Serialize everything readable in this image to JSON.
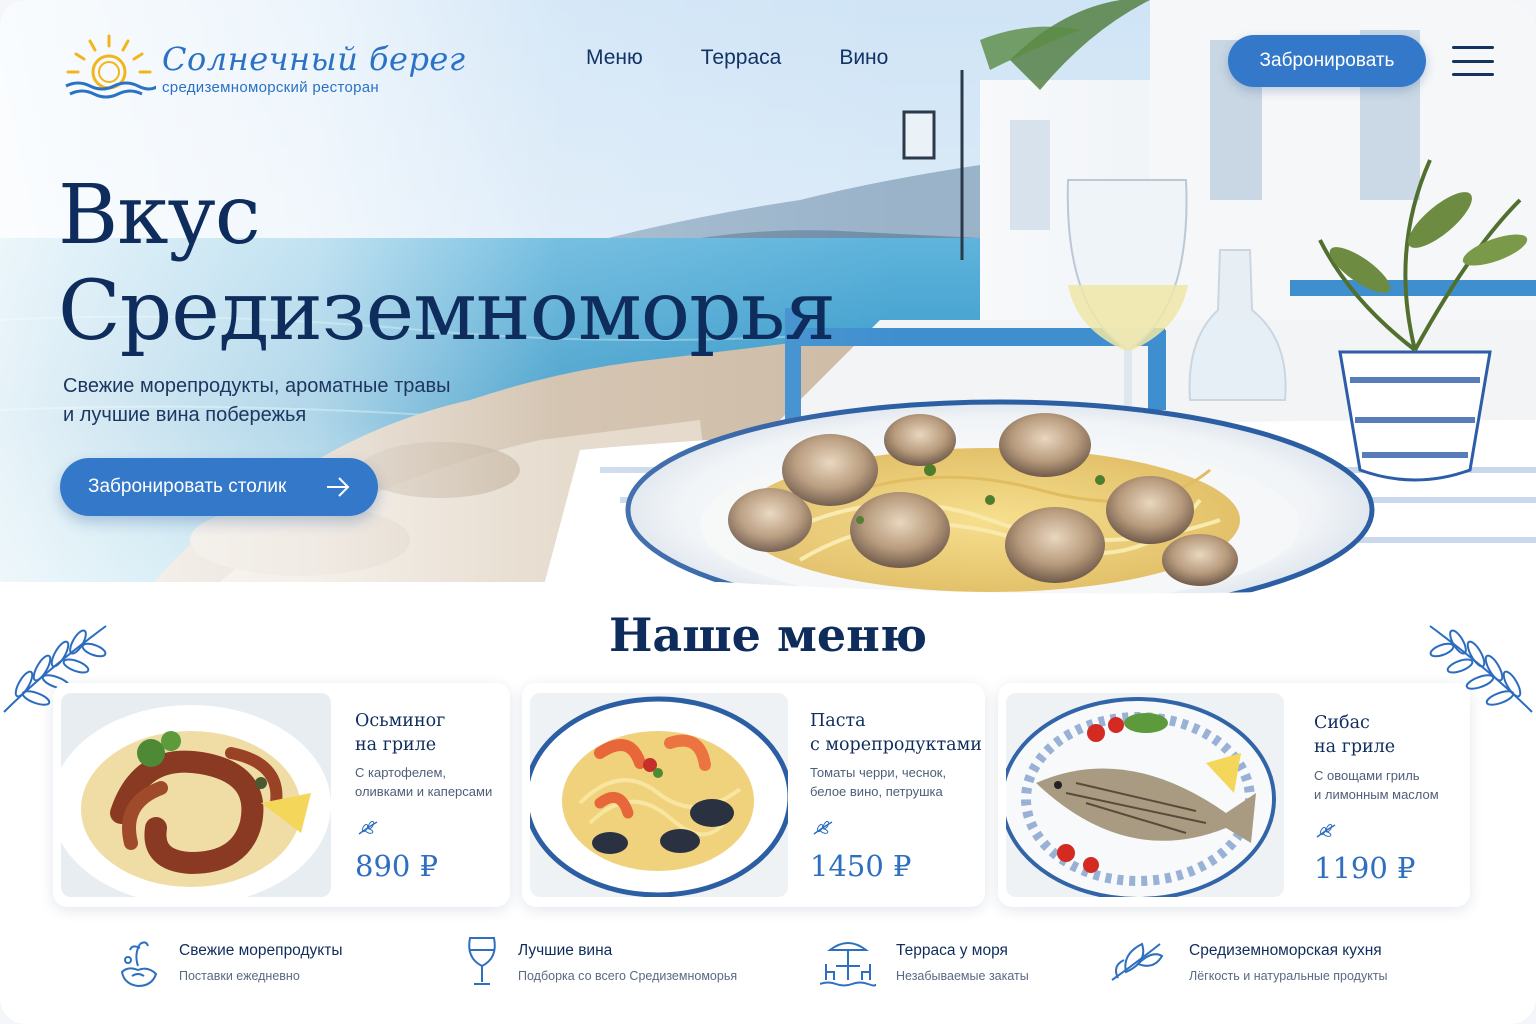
{
  "brand": {
    "name": "Солнечный берег",
    "tagline": "средиземноморский ресторан"
  },
  "nav": {
    "items": [
      "Меню",
      "Терраса",
      "Вино"
    ],
    "book_button": "Забронировать"
  },
  "hero": {
    "title_line1": "Вкус",
    "title_line2": "Средиземноморья",
    "subtitle_line1": "Свежие морепродукты, ароматные травы",
    "subtitle_line2": "и лучшие вина побережья",
    "cta": "Забронировать столик"
  },
  "menu": {
    "title": "Наше меню",
    "items": [
      {
        "title_line1": "Осьминог",
        "title_line2": "на гриле",
        "desc_line1": "С картофелем,",
        "desc_line2": "оливками и каперсами",
        "price": "890 ₽"
      },
      {
        "title_line1": "Паста",
        "title_line2": "с морепродуктами",
        "desc_line1": "Томаты черри, чеснок,",
        "desc_line2": "белое вино, петрушка",
        "price": "1450 ₽"
      },
      {
        "title_line1": "Сибас",
        "title_line2": "на гриле",
        "desc_line1": "С овощами гриль",
        "desc_line2": "и лимонным маслом",
        "price": "1190 ₽"
      }
    ]
  },
  "features": [
    {
      "icon": "seafood-icon",
      "title": "Свежие морепродукты",
      "subtitle": "Поставки ежедневно"
    },
    {
      "icon": "wine-glass-icon",
      "title": "Лучшие вина",
      "subtitle": "Подборка со всего Средиземноморья"
    },
    {
      "icon": "terrace-icon",
      "title": "Терраса у моря",
      "subtitle": "Незабываемые закаты"
    },
    {
      "icon": "olive-branch-icon",
      "title": "Средиземноморская кухня",
      "subtitle": "Лёгкость и натуральные продукты"
    }
  ],
  "colors": {
    "primary": "#3479c9",
    "navy": "#0f2d5c",
    "price": "#2e6fbf",
    "sea": "#3aa0c8"
  }
}
